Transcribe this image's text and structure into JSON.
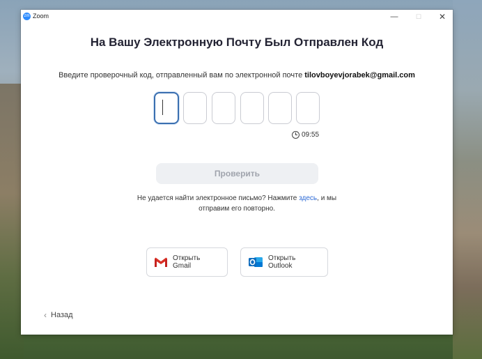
{
  "window": {
    "app_title": "Zoom",
    "logo_text": "zm",
    "controls": {
      "minimize": "—",
      "maximize": "☐",
      "close": "✕"
    }
  },
  "heading": "На Вашу Электронную Почту Был Отправлен Код",
  "instruction": {
    "text": "Введите проверочный код, отправленный вам по электронной почте ",
    "email": "tilovboyevjorabek@gmail.com"
  },
  "code_boxes": [
    "",
    "",
    "",
    "",
    "",
    ""
  ],
  "timer": "09:55",
  "verify_button": "Проверить",
  "resend": {
    "before": "Не удается найти электронное письмо? Нажмите ",
    "link": "здесь",
    "after": ", и мы отправим его повторно."
  },
  "open_gmail": "Открыть Gmail",
  "open_outlook": "Открыть Outlook",
  "back": "Назад",
  "colors": {
    "accent": "#2d8cff",
    "link": "#2d6bd6",
    "gmail_red": "#d93025",
    "outlook_blue": "#0f6cbd"
  }
}
